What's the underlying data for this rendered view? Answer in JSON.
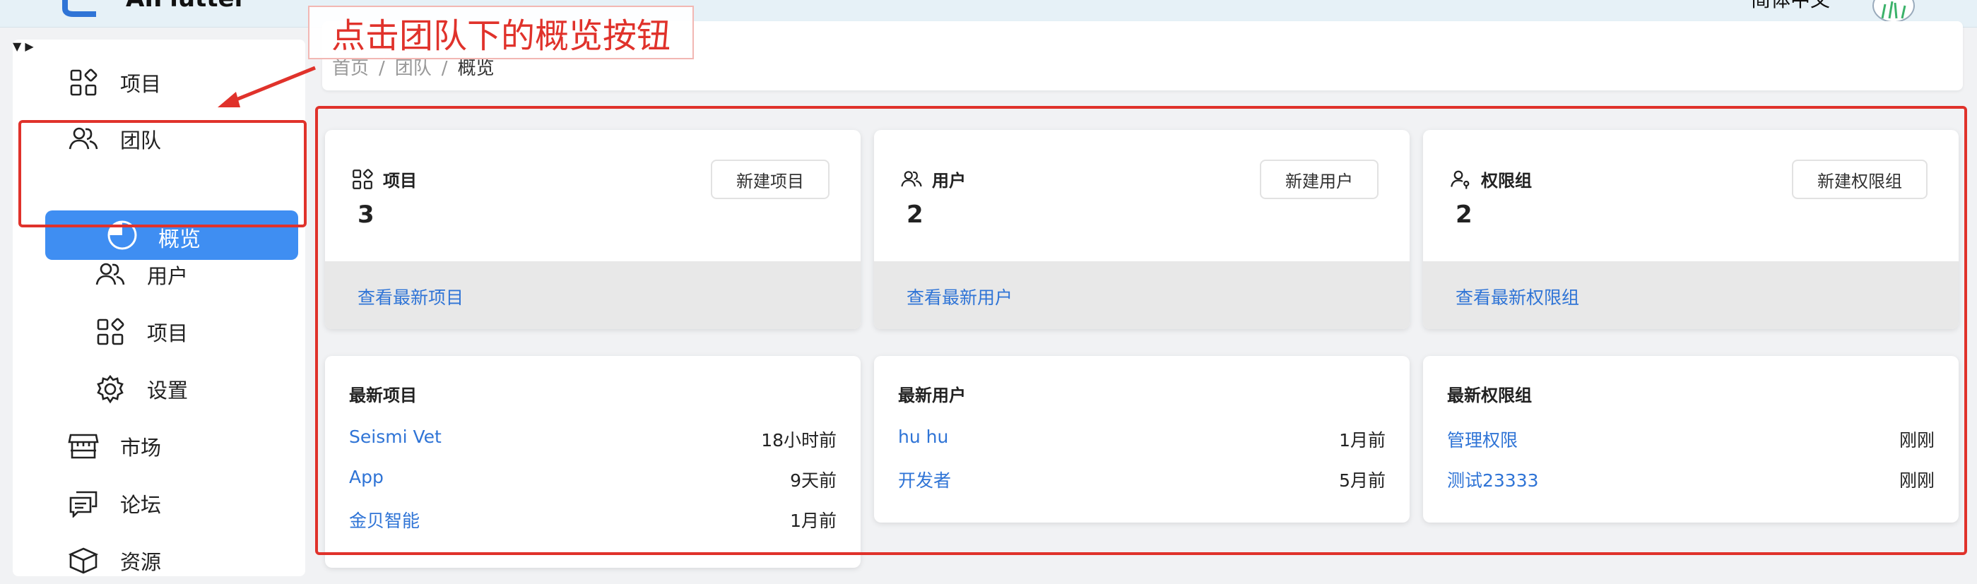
{
  "header": {
    "app_title": "AIFlutter",
    "language": "简体中文"
  },
  "sidebar": {
    "items": [
      {
        "label": "项目",
        "icon": "grid-icon"
      },
      {
        "label": "团队",
        "icon": "users-icon",
        "expanded": true
      },
      {
        "label": "概览",
        "icon": "pie-chart-icon",
        "active": true
      },
      {
        "label": "用户",
        "icon": "users-icon"
      },
      {
        "label": "项目",
        "icon": "grid-icon"
      },
      {
        "label": "设置",
        "icon": "gear-icon"
      },
      {
        "label": "市场",
        "icon": "store-icon"
      },
      {
        "label": "论坛",
        "icon": "chat-icon"
      },
      {
        "label": "资源",
        "icon": "cube-icon",
        "expanded": false
      }
    ]
  },
  "breadcrumb": {
    "items": [
      "首页",
      "团队",
      "概览"
    ],
    "separator": "/"
  },
  "stats": [
    {
      "title": "项目",
      "count": "3",
      "button": "新建项目",
      "link": "查看最新项目",
      "icon": "grid-icon"
    },
    {
      "title": "用户",
      "count": "2",
      "button": "新建用户",
      "link": "查看最新用户",
      "icon": "users-icon"
    },
    {
      "title": "权限组",
      "count": "2",
      "button": "新建权限组",
      "link": "查看最新权限组",
      "icon": "user-key-icon"
    }
  ],
  "lists": [
    {
      "title": "最新项目",
      "rows": [
        {
          "name": "Seismi Vet",
          "time": "18小时前"
        },
        {
          "name": "App",
          "time": "9天前"
        },
        {
          "name": "金贝智能",
          "time": "1月前"
        }
      ]
    },
    {
      "title": "最新用户",
      "rows": [
        {
          "name": "hu hu",
          "time": "1月前"
        },
        {
          "name": "开发者",
          "time": "5月前"
        }
      ]
    },
    {
      "title": "最新权限组",
      "rows": [
        {
          "name": "管理权限",
          "time": "刚刚"
        },
        {
          "name": "测试23333",
          "time": "刚刚"
        }
      ]
    }
  ],
  "annotation": {
    "label": "点击团队下的概览按钮",
    "color": "#e0322b"
  },
  "colors": {
    "accent": "#3f8ef2",
    "link": "#2f74d6"
  }
}
